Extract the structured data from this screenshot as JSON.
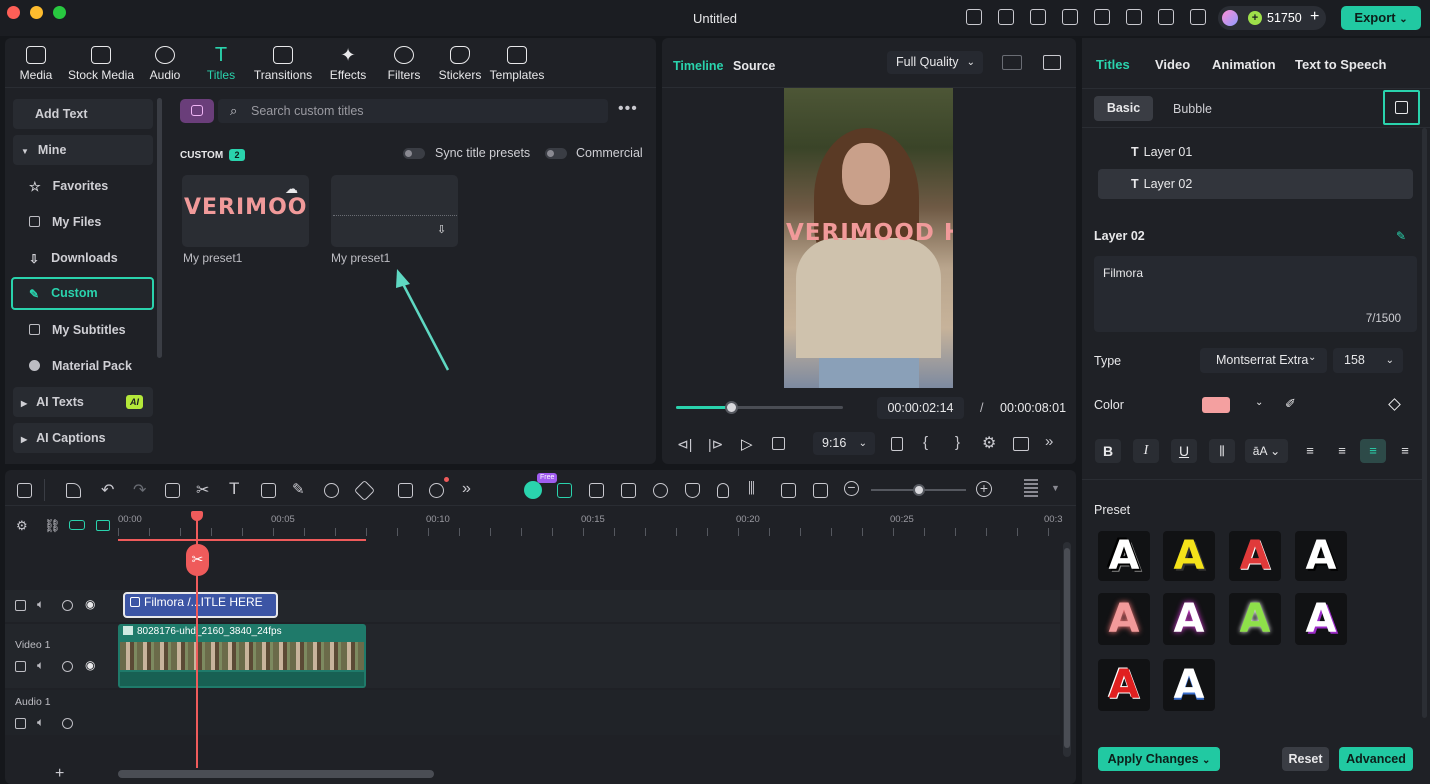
{
  "window": {
    "title": "Untitled"
  },
  "titlebar": {
    "credits": "51750",
    "export_label": "Export"
  },
  "media_tabs": [
    {
      "label": "Media"
    },
    {
      "label": "Stock Media"
    },
    {
      "label": "Audio"
    },
    {
      "label": "Titles"
    },
    {
      "label": "Transitions"
    },
    {
      "label": "Effects"
    },
    {
      "label": "Filters"
    },
    {
      "label": "Stickers"
    },
    {
      "label": "Templates"
    }
  ],
  "sidebar": {
    "add_text": "Add Text",
    "mine": "Mine",
    "items": [
      {
        "label": "Favorites"
      },
      {
        "label": "My Files"
      },
      {
        "label": "Downloads"
      },
      {
        "label": "Custom"
      },
      {
        "label": "My Subtitles"
      },
      {
        "label": "Material Pack"
      }
    ],
    "ai_texts": "AI Texts",
    "ai_badge": "AI",
    "ai_captions": "AI Captions"
  },
  "library": {
    "search_placeholder": "Search custom titles",
    "section_label": "CUSTOM",
    "section_count": "2",
    "sync_label": "Sync title presets",
    "commercial_label": "Commercial",
    "thumb_text": "VERIMOOD H",
    "presets": [
      {
        "label": "My preset1"
      },
      {
        "label": "My preset1"
      }
    ]
  },
  "preview": {
    "tab_timeline": "Timeline",
    "tab_source": "Source",
    "quality": "Full Quality",
    "overlay_text": "VERIMOOD H",
    "progress": 0.33,
    "current_time": "00:00:02:14",
    "separator": "/",
    "total_time": "00:00:08:01",
    "aspect": "9:16"
  },
  "timeline": {
    "free_badge": "Free",
    "ruler": [
      "00:00",
      "00:05",
      "00:10",
      "00:15",
      "00:20",
      "00:25",
      "00:3"
    ],
    "title_clip": "Filmora /...ITLE HERE",
    "video_clip": "8028176-uhd_2160_3840_24fps",
    "video_track": "Video 1",
    "audio_track": "Audio 1"
  },
  "properties": {
    "tabs": [
      {
        "label": "Titles"
      },
      {
        "label": "Video"
      },
      {
        "label": "Animation"
      },
      {
        "label": "Text to Speech"
      }
    ],
    "subtabs": [
      {
        "label": "Basic"
      },
      {
        "label": "Bubble"
      }
    ],
    "layers": [
      {
        "label": "Layer 01"
      },
      {
        "label": "Layer 02"
      }
    ],
    "layer_heading": "Layer 02",
    "text_value": "Filmora",
    "char_count": "7/1500",
    "type_label": "Type",
    "font": "Montserrat Extra",
    "font_size": "158",
    "color_label": "Color",
    "color_value": "#f4a0a0",
    "preset_label": "Preset",
    "apply_label": "Apply Changes",
    "reset_label": "Reset",
    "advanced_label": "Advanced"
  },
  "colors": {
    "accent": "#2ad3ad",
    "playhead": "#ef5b5b",
    "title_clip": "#3c55a5",
    "video_clip": "#1f7a6a"
  }
}
